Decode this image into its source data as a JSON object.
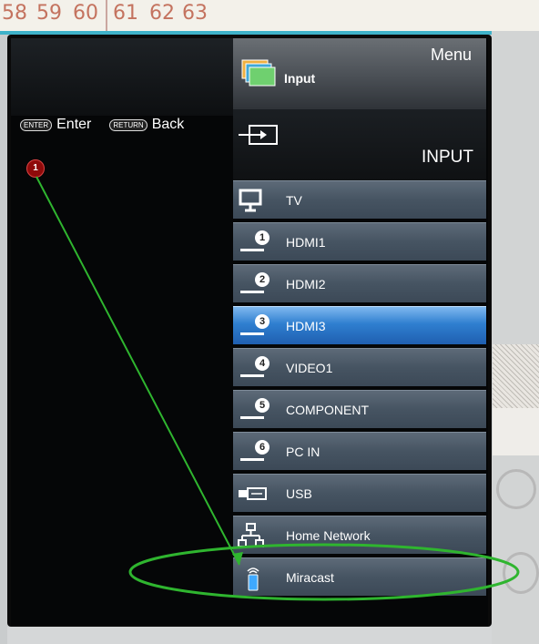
{
  "ruler": {
    "numbers": [
      "58",
      "59",
      "60",
      "61",
      "62",
      "63"
    ]
  },
  "hints": {
    "enter_key": "ENTER",
    "enter_label": "Enter",
    "return_key": "RETURN",
    "return_label": "Back"
  },
  "annotation": {
    "badge": "1",
    "arrow_color": "#2fb52f",
    "ellipse_color": "#2fb52f",
    "badge_color": "#8f0a0a"
  },
  "menu": {
    "title": "Menu",
    "header_label": "Input",
    "section_label": "INPUT",
    "items": [
      {
        "label": "TV",
        "icon": "tv-icon",
        "num": ""
      },
      {
        "label": "HDMI1",
        "icon": "hdmi-port-icon",
        "num": "1"
      },
      {
        "label": "HDMI2",
        "icon": "hdmi-port-icon",
        "num": "2"
      },
      {
        "label": "HDMI3",
        "icon": "hdmi-port-icon",
        "num": "3",
        "selected": true
      },
      {
        "label": "VIDEO1",
        "icon": "video-port-icon",
        "num": "4"
      },
      {
        "label": "COMPONENT",
        "icon": "component-port-icon",
        "num": "5"
      },
      {
        "label": "PC IN",
        "icon": "pc-port-icon",
        "num": "6"
      },
      {
        "label": "USB",
        "icon": "usb-icon",
        "num": ""
      },
      {
        "label": "Home Network",
        "icon": "network-icon",
        "num": ""
      },
      {
        "label": "Miracast",
        "icon": "miracast-icon",
        "num": ""
      }
    ],
    "selected_color": "#2f7fd0",
    "item_color": "#465462"
  }
}
